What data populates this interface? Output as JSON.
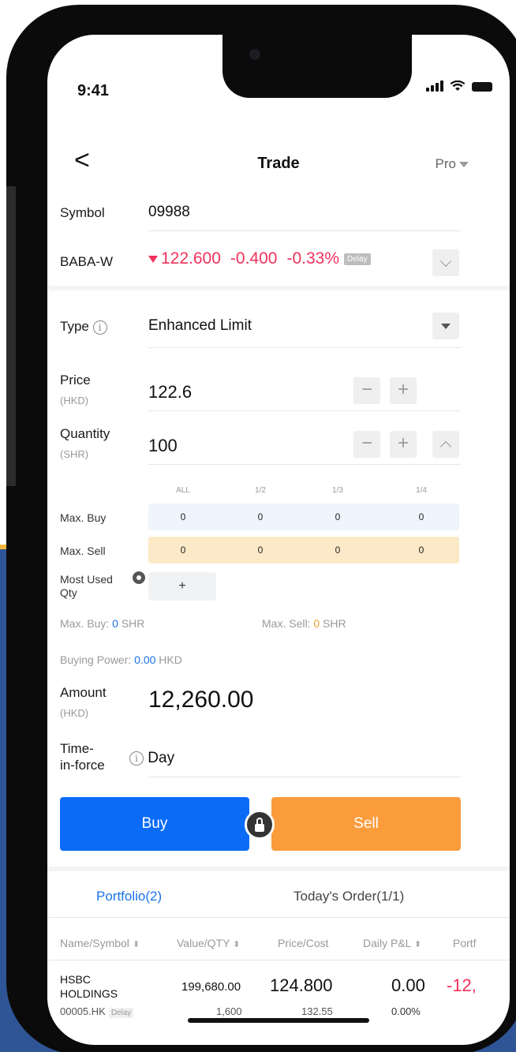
{
  "status": {
    "time": "9:41"
  },
  "nav": {
    "back": "<",
    "title": "Trade",
    "mode": "Pro"
  },
  "symbol": {
    "label": "Symbol",
    "value": "09988"
  },
  "stock": {
    "name": "BABA-W",
    "price": "122.600",
    "change": "-0.400",
    "change_pct": "-0.33%",
    "delay": "Delay",
    "color": "#f2305c"
  },
  "type": {
    "label": "Type",
    "value": "Enhanced Limit"
  },
  "price": {
    "label": "Price",
    "unit": "(HKD)",
    "value": "122.6"
  },
  "quantity": {
    "label": "Quantity",
    "unit": "(SHR)",
    "value": "100"
  },
  "steppers": {
    "minus": "−",
    "plus": "+"
  },
  "fractions": [
    "ALL",
    "1/2",
    "1/3",
    "1/4"
  ],
  "max_buy_row": {
    "label": "Max. Buy",
    "values": [
      "0",
      "0",
      "0",
      "0"
    ]
  },
  "max_sell_row": {
    "label": "Max. Sell",
    "values": [
      "0",
      "0",
      "0",
      "0"
    ]
  },
  "most_used": {
    "line1": "Most Used",
    "line2": "Qty",
    "add": "+"
  },
  "summary": {
    "max_buy_label": "Max. Buy: ",
    "max_buy_value": "0",
    "max_buy_unit": " SHR",
    "max_sell_label": "Max. Sell: ",
    "max_sell_value": "0",
    "max_sell_unit": " SHR",
    "buying_power_label": "Buying Power: ",
    "buying_power_value": "0.00",
    "buying_power_unit": " HKD"
  },
  "amount": {
    "label": "Amount",
    "unit": "(HKD)",
    "value": "12,260.00"
  },
  "tif": {
    "line1": "Time-",
    "line2": "in-force",
    "value": "Day",
    "info": "i"
  },
  "actions": {
    "buy": "Buy",
    "sell": "Sell"
  },
  "tabs": {
    "portfolio": "Portfolio(2)",
    "orders": "Today's Order(1/1)"
  },
  "table": {
    "headers": [
      "Name/Symbol",
      "Value/QTY",
      "Price/Cost",
      "Daily P&L",
      "Portf"
    ],
    "row": {
      "name_line1": "HSBC",
      "name_line2": "HOLDINGS",
      "code": "00005.HK",
      "delay": "Delay",
      "value": "199,680.00",
      "qty": "1,600",
      "price": "124.800",
      "cost": "132.55",
      "daily_pnl": "0.00",
      "daily_pnl_pct": "0.00%",
      "portfolio_pnl": "-12,"
    }
  }
}
